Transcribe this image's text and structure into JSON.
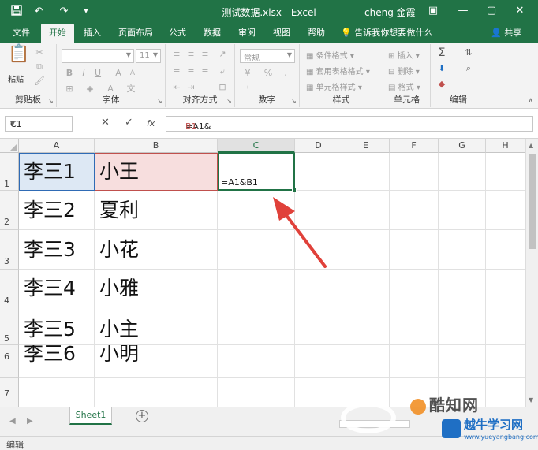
{
  "titlebar": {
    "title": "测试数据.xlsx  -  Excel",
    "user": "cheng 金霞",
    "save_icon": "save-icon",
    "undo_icon": "undo-icon",
    "redo_icon": "redo-icon",
    "customize_icon": "customize-icon"
  },
  "tabs": [
    "文件",
    "开始",
    "插入",
    "页面布局",
    "公式",
    "数据",
    "审阅",
    "视图",
    "帮助"
  ],
  "active_tab": "开始",
  "tell_me": "告诉我你想要做什么",
  "share": "共享",
  "ribbon": {
    "clipboard": {
      "label": "剪贴板",
      "paste": "粘贴"
    },
    "font": {
      "label": "字体",
      "name": "",
      "size": "11"
    },
    "alignment": {
      "label": "对齐方式"
    },
    "number": {
      "label": "数字",
      "format": "常规"
    },
    "styles": {
      "label": "样式",
      "conditional": "条件格式",
      "table": "套用表格格式",
      "cell_styles": "单元格样式"
    },
    "cells": {
      "label": "单元格",
      "insert": "插入",
      "delete": "删除",
      "format": "格式"
    },
    "editing": {
      "label": "编辑"
    }
  },
  "formula_bar": {
    "name_box": "C1",
    "formula_prefix": "=A1&",
    "formula_suffix": "B1",
    "fx": "fx"
  },
  "columns": [
    "A",
    "B",
    "C",
    "D",
    "E",
    "F",
    "G",
    "H"
  ],
  "rows": [
    {
      "num": "1",
      "a": "李三1",
      "b": "小王",
      "c": "=A1&B1"
    },
    {
      "num": "2",
      "a": "李三2",
      "b": "夏利",
      "c": ""
    },
    {
      "num": "3",
      "a": "李三3",
      "b": "小花",
      "c": ""
    },
    {
      "num": "4",
      "a": "李三4",
      "b": "小雅",
      "c": ""
    },
    {
      "num": "5",
      "a": "李三5",
      "b": "小主",
      "c": ""
    },
    {
      "num": "6",
      "a": "李三6",
      "b": "小明",
      "c": ""
    },
    {
      "num": "7",
      "a": "",
      "b": "",
      "c": ""
    }
  ],
  "sheet_tab": "Sheet1",
  "status": "编辑",
  "watermarks": {
    "site1": "酷知网",
    "site2": "越牛学习网",
    "site2_url": "www.yueyangbang.com"
  },
  "colors": {
    "excel_green": "#217346",
    "arrow_red": "#e0413a",
    "ref_blue": "#2f6bb5",
    "ref_red": "#c0504d"
  }
}
